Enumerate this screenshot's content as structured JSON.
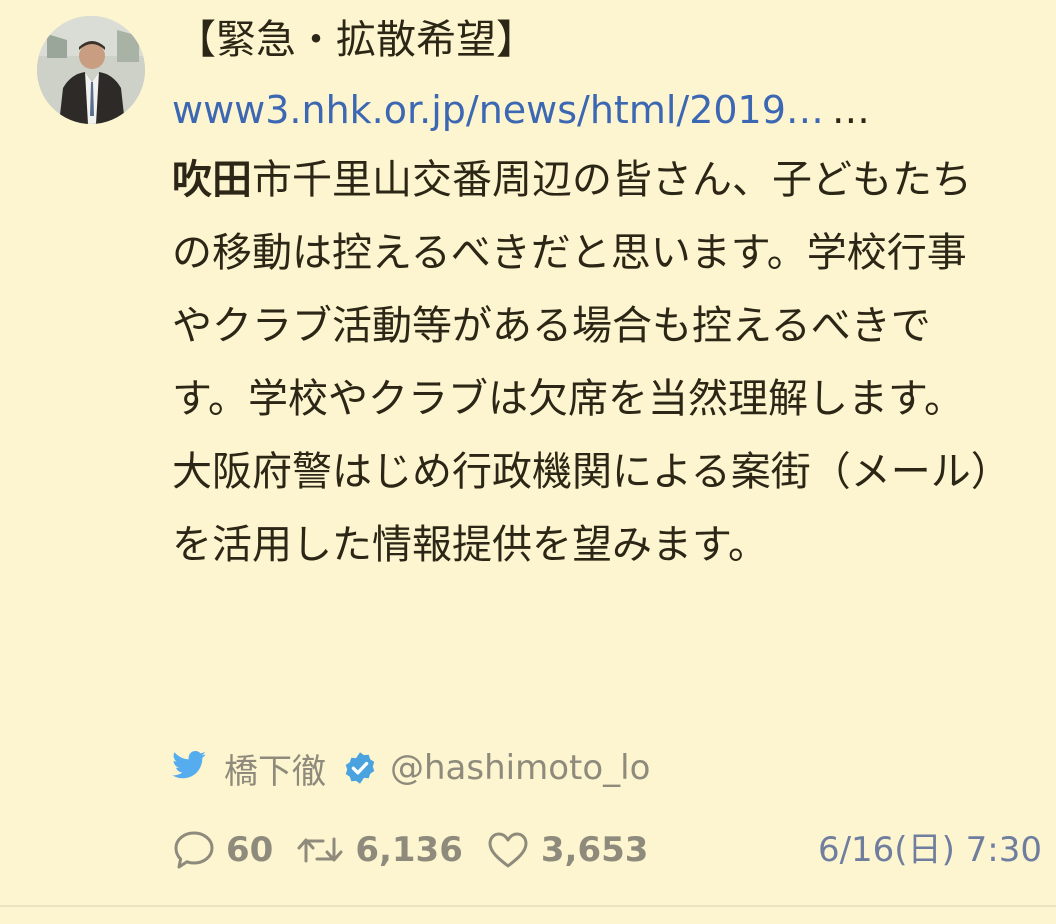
{
  "tweet": {
    "headline": "【緊急・拡散希望】",
    "link": {
      "text": "www3.nhk.or.jp/news/html/2019…",
      "more": "…"
    },
    "body_bold": "吹田",
    "body_rest": "市千里山交番周辺の皆さん、子どもたちの移動は控えるべきだと思います。学校行事やクラブ活動等がある場合も控えるべきです。学校やクラブは欠席を当然理解します。大阪府警はじめ行政機関による案街（メール）を活用した情報提供を望みます。",
    "author": {
      "name": "橋下徹",
      "handle": "@hashimoto_lo",
      "verified": true
    },
    "stats": {
      "replies": "60",
      "retweets": "6,136",
      "likes": "3,653"
    },
    "timestamp": "6/16(日) 7:30"
  },
  "icons": [
    "avatar",
    "twitter-bird-icon",
    "verified-badge-icon",
    "reply-icon",
    "retweet-icon",
    "like-icon"
  ],
  "colors": {
    "background": "#fdf5cf",
    "text": "#2c2616",
    "link": "#3c67b3",
    "meta": "#8e8a7c",
    "bird": "#55acee",
    "verified": "#4aa3df",
    "timestamp": "#6f7e9e"
  }
}
